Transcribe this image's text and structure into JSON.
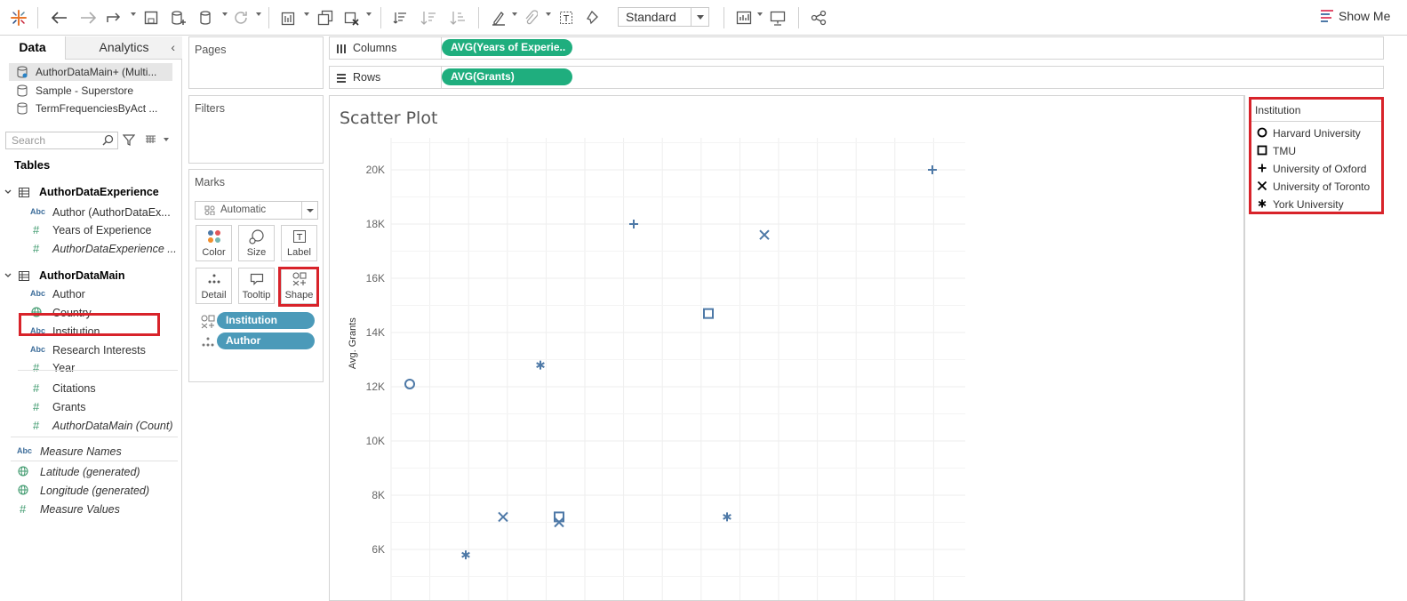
{
  "toolbar": {
    "mark_size_dropdown": "Standard",
    "show_me": "Show Me"
  },
  "left_panel": {
    "tabs": {
      "data": "Data",
      "analytics": "Analytics"
    },
    "datasources": [
      "AuthorDataMain+ (Multi...",
      "Sample - Superstore",
      "TermFrequenciesByAct ..."
    ],
    "search_placeholder": "Search",
    "tables_heading": "Tables",
    "tables": [
      {
        "name": "AuthorDataExperience",
        "fields": [
          {
            "type": "Abc",
            "name": "Author (AuthorDataEx...",
            "italic": false
          },
          {
            "type": "#",
            "name": "Years of Experience",
            "italic": false
          },
          {
            "type": "#",
            "name": "AuthorDataExperience ...",
            "italic": true
          }
        ]
      },
      {
        "name": "AuthorDataMain",
        "fields": [
          {
            "type": "Abc",
            "name": "Author",
            "italic": false
          },
          {
            "type": "globe",
            "name": "Country",
            "italic": false
          },
          {
            "type": "Abc",
            "name": "Institution",
            "italic": false
          },
          {
            "type": "Abc",
            "name": "Research Interests",
            "italic": false
          },
          {
            "type": "#",
            "name": "Year",
            "italic": false
          },
          {
            "type": "#",
            "name": "Citations",
            "italic": false
          },
          {
            "type": "#",
            "name": "Grants",
            "italic": false
          },
          {
            "type": "#",
            "name": "AuthorDataMain (Count)",
            "italic": true
          }
        ]
      }
    ],
    "extra_fields": [
      {
        "type": "Abc",
        "name": "Measure Names"
      },
      {
        "type": "globe",
        "name": "Latitude (generated)"
      },
      {
        "type": "globe",
        "name": "Longitude (generated)"
      },
      {
        "type": "#",
        "name": "Measure Values"
      }
    ]
  },
  "cards": {
    "pages": "Pages",
    "filters": "Filters",
    "marks": "Marks",
    "mark_type": "Automatic",
    "buttons": [
      "Color",
      "Size",
      "Label",
      "Detail",
      "Tooltip",
      "Shape"
    ],
    "mark_pills": [
      "Institution",
      "Author"
    ]
  },
  "shelves": {
    "columns_label": "Columns",
    "columns_pill": "AVG(Years of Experie..",
    "rows_label": "Rows",
    "rows_pill": "AVG(Grants)"
  },
  "view": {
    "title": "Scatter Plot"
  },
  "legend": {
    "title": "Institution",
    "items": [
      {
        "label": "Harvard University",
        "shape": "circle"
      },
      {
        "label": "TMU",
        "shape": "square"
      },
      {
        "label": "University of Oxford",
        "shape": "plus"
      },
      {
        "label": "University of Toronto",
        "shape": "cross"
      },
      {
        "label": "York University",
        "shape": "asterisk"
      }
    ]
  },
  "chart_data": {
    "type": "scatter",
    "title": "Scatter Plot",
    "xlabel": "",
    "ylabel": "Avg. Grants",
    "y_ticks": [
      "6K",
      "8K",
      "10K",
      "12K",
      "14K",
      "16K",
      "18K",
      "20K"
    ],
    "ylim": [
      5400,
      21300
    ],
    "x_tick_labels_visible": false,
    "grid": true,
    "legend": "right",
    "mark_color": "#4e79a7",
    "points": [
      {
        "institution": "Harvard University",
        "shape": "circle",
        "x": 1,
        "y": 12100
      },
      {
        "institution": "York University",
        "shape": "asterisk",
        "x": 2.5,
        "y": 5800
      },
      {
        "institution": "University of Toronto",
        "shape": "cross",
        "x": 3.5,
        "y": 7200
      },
      {
        "institution": "York University",
        "shape": "asterisk",
        "x": 4.5,
        "y": 12800
      },
      {
        "institution": "TMU",
        "shape": "square",
        "x": 5,
        "y": 7200
      },
      {
        "institution": "University of Toronto",
        "shape": "cross",
        "x": 5,
        "y": 7000
      },
      {
        "institution": "University of Oxford",
        "shape": "plus",
        "x": 7,
        "y": 18000
      },
      {
        "institution": "TMU",
        "shape": "square",
        "x": 9,
        "y": 14700
      },
      {
        "institution": "York University",
        "shape": "asterisk",
        "x": 9.5,
        "y": 7200
      },
      {
        "institution": "University of Toronto",
        "shape": "cross",
        "x": 10.5,
        "y": 17600
      },
      {
        "institution": "University of Oxford",
        "shape": "plus",
        "x": 15,
        "y": 20000
      }
    ]
  }
}
